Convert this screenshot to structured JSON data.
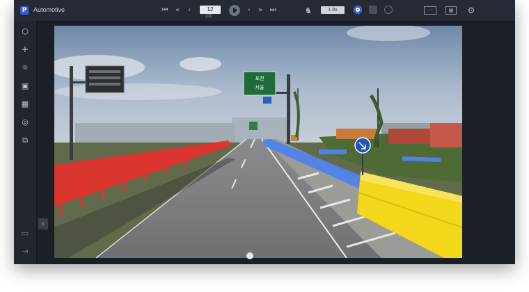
{
  "app": {
    "title": "Automotive",
    "logo_letter": "P"
  },
  "playback": {
    "frame": "12",
    "total_frames": "200"
  },
  "speed": {
    "value": "1.0x"
  },
  "colors": {
    "window_bg": "#1b1f26",
    "topbar_bg": "#262a33",
    "accent": "#3b5bdb",
    "mask_red": "#e5312b",
    "mask_blue": "#4f82e8",
    "mask_yellow": "#f2d71a"
  },
  "toolbar_icons": [
    "skip-start-icon",
    "prev-keyframe-icon",
    "prev-frame-icon",
    "play-icon",
    "next-frame-icon",
    "next-keyframe-icon",
    "skip-end-icon",
    "runner-icon",
    "mode-point-icon",
    "mode-box-icon",
    "mode-globe-icon",
    "keyboard-icon",
    "grid-icon",
    "gear-icon"
  ],
  "sidebar_icons": [
    "polygon-icon",
    "crosshair-icon",
    "brightness-icon",
    "bookmark-icon",
    "grid-icon",
    "toggle-icon",
    "copy-icon",
    "save-icon",
    "exit-icon"
  ],
  "scene": {
    "sign_text_1": "포천",
    "sign_text_2": "서울"
  }
}
